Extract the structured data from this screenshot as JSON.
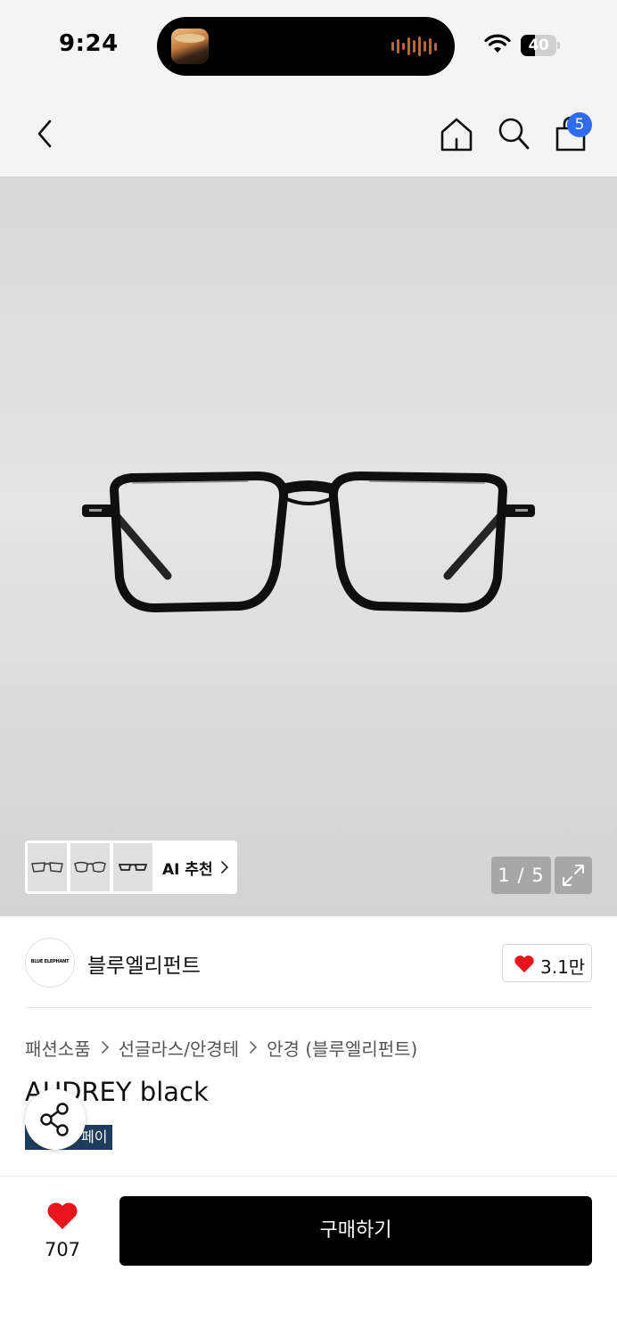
{
  "status_bar": {
    "time": "9:24",
    "battery_level": "40",
    "battery_fraction": 0.4
  },
  "nav": {
    "cart_count": "5",
    "icons": [
      "back-chevron-icon",
      "home-icon",
      "search-icon",
      "shopping-bag-icon"
    ]
  },
  "gallery": {
    "ai_recommend_label": "AI 추천",
    "page_counter": "1 / 5"
  },
  "brand": {
    "logo_text": "BLUE ELEPHANT",
    "name": "블루엘리펀트",
    "like_count": "3.1만"
  },
  "breadcrumb": [
    "패션소품",
    "선글라스/안경테",
    "안경 (블루엘리펀트)"
  ],
  "product": {
    "title": "AUDREY black",
    "pay_badge": "페이"
  },
  "bottom_bar": {
    "wish_count": "707",
    "buy_label": "구매하기"
  },
  "colors": {
    "accent_badge": "#2f6bf0",
    "heart": "#e8141c",
    "buy_button": "#000000",
    "pay_badge": "#1d3d5c"
  }
}
